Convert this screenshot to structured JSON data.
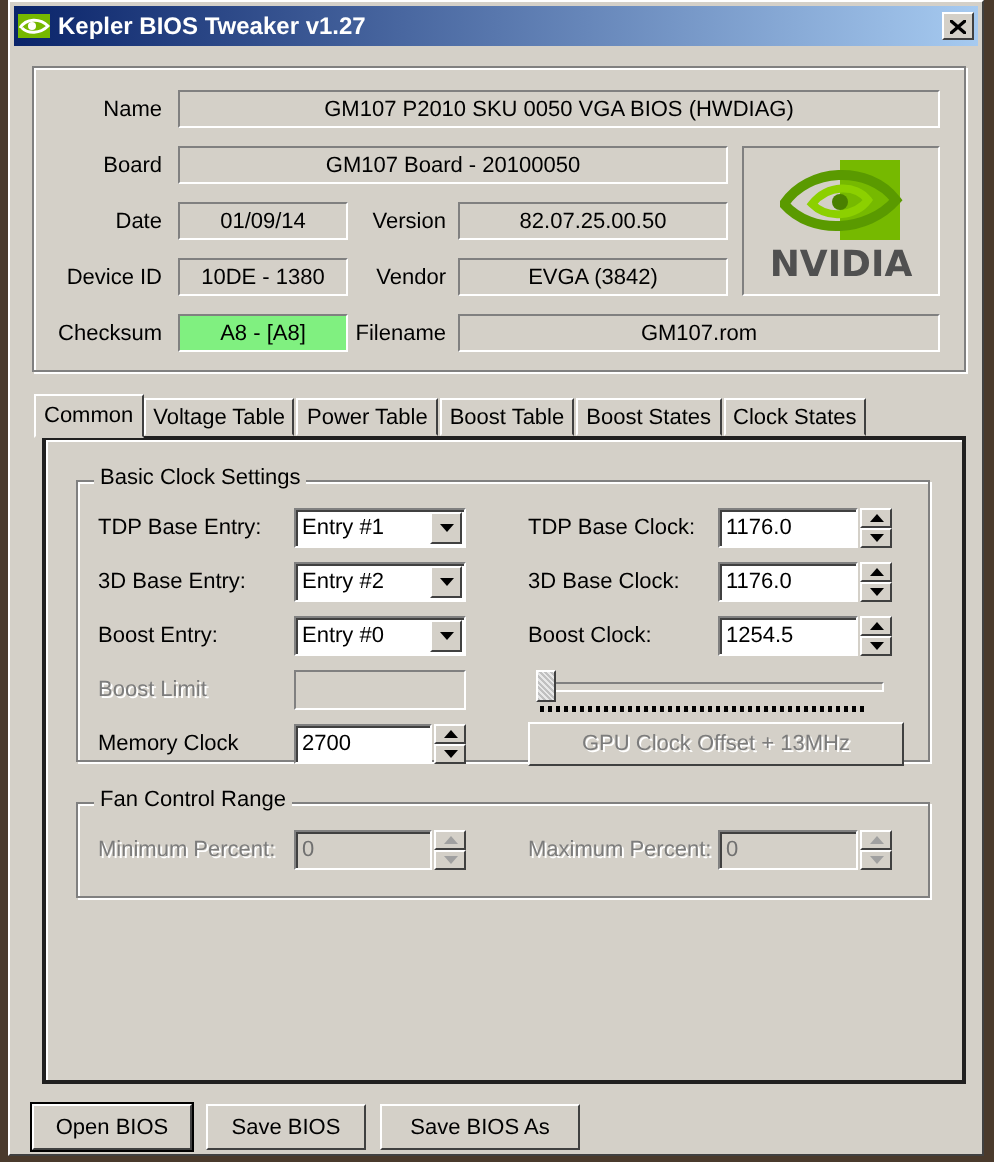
{
  "window": {
    "title": "Kepler BIOS Tweaker v1.27"
  },
  "info": {
    "name": {
      "label": "Name",
      "value": "GM107 P2010 SKU 0050 VGA BIOS (HWDIAG)"
    },
    "board": {
      "label": "Board",
      "value": "GM107 Board - 20100050"
    },
    "date": {
      "label": "Date",
      "value": "01/09/14"
    },
    "version": {
      "label": "Version",
      "value": "82.07.25.00.50"
    },
    "device_id": {
      "label": "Device ID",
      "value": "10DE - 1380"
    },
    "vendor": {
      "label": "Vendor",
      "value": "EVGA (3842)"
    },
    "checksum": {
      "label": "Checksum",
      "value": "A8 - [A8]",
      "valid": true
    },
    "filename": {
      "label": "Filename",
      "value": "GM107.rom"
    }
  },
  "logo": {
    "text": "NVIDIA"
  },
  "tabs": [
    {
      "label": "Common",
      "selected": true
    },
    {
      "label": "Voltage Table",
      "selected": false
    },
    {
      "label": "Power Table",
      "selected": false
    },
    {
      "label": "Boost Table",
      "selected": false
    },
    {
      "label": "Boost States",
      "selected": false
    },
    {
      "label": "Clock States",
      "selected": false
    }
  ],
  "basic_clock_settings": {
    "title": "Basic Clock Settings",
    "entries": [
      {
        "label": "TDP Base Entry:",
        "value": "Entry #1"
      },
      {
        "label": "3D Base Entry:",
        "value": "Entry #2"
      },
      {
        "label": "Boost Entry:",
        "value": "Entry #0"
      }
    ],
    "clocks": [
      {
        "label": "TDP Base Clock:",
        "value": "1176.0"
      },
      {
        "label": "3D Base Clock:",
        "value": "1176.0"
      },
      {
        "label": "Boost Clock:",
        "value": "1254.5"
      }
    ],
    "boost_limit": {
      "label": "Boost Limit",
      "disabled": true
    },
    "memory_clock": {
      "label": "Memory Clock",
      "value": "2700"
    },
    "offset_slider": {
      "level": 0
    },
    "offset_button": {
      "label": "GPU Clock Offset + 13MHz",
      "disabled": true
    }
  },
  "fan_control_range": {
    "title": "Fan Control Range",
    "disabled": true,
    "fields": [
      {
        "label": "Minimum Percent:",
        "value": "0"
      },
      {
        "label": "Maximum Percent:",
        "value": "0"
      }
    ]
  },
  "buttons": [
    {
      "label": "Open BIOS",
      "default": true
    },
    {
      "label": "Save BIOS",
      "default": false
    },
    {
      "label": "Save BIOS As",
      "default": false
    }
  ]
}
